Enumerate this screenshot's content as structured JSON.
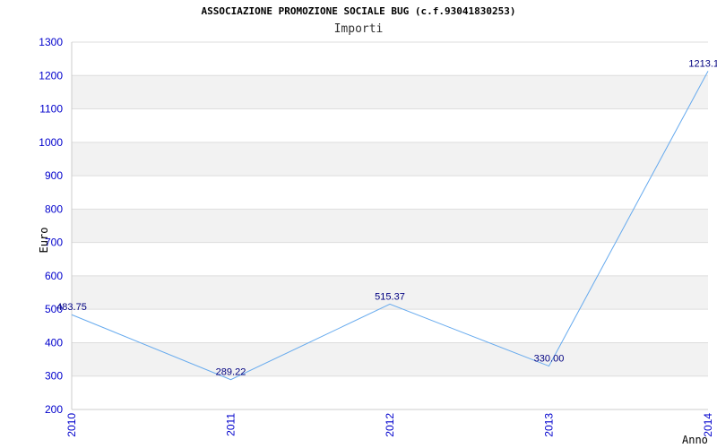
{
  "chart_data": {
    "type": "line",
    "title": "ASSOCIAZIONE PROMOZIONE SOCIALE BUG (c.f.93041830253)",
    "subtitle": "Importi",
    "xlabel": "Anno",
    "ylabel": "Euro",
    "categories": [
      "2010",
      "2011",
      "2012",
      "2013",
      "2014"
    ],
    "series": [
      {
        "values": [
          483.75,
          289.22,
          515.37,
          330.0,
          1213.1
        ],
        "labels": [
          "483.75",
          "289.22",
          "515.37",
          "330.00",
          "1213.1"
        ]
      }
    ],
    "ylim": [
      200,
      1300
    ],
    "yticks": [
      200,
      300,
      400,
      500,
      600,
      700,
      800,
      900,
      1000,
      1100,
      1200,
      1300
    ],
    "grid": true,
    "colors": {
      "line": "#66aaee",
      "band": "#f2f2f2",
      "gridline": "#dddddd",
      "tick_text": "#0000cc",
      "data_label": "#000080"
    }
  }
}
